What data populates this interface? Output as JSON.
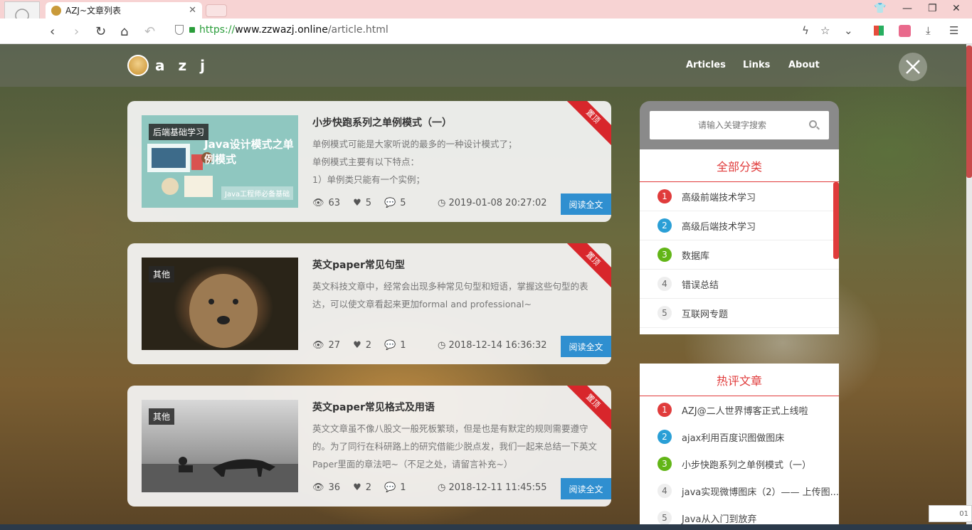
{
  "browser": {
    "tab_title": "AZJ~文章列表",
    "url_scheme": "https://",
    "url_domain": "www.zzwazj.online",
    "url_path": "/article.html"
  },
  "header": {
    "logo_text": "a z j",
    "nav": [
      "Articles",
      "Links",
      "About"
    ]
  },
  "articles": [
    {
      "thumb_tag": "后端基础学习",
      "thumb_title": "Java设计模式之单例模式",
      "thumb_sub": "Java工程师必备基础",
      "title": "小步快跑系列之单例模式（一）",
      "desc": [
        "单例模式可能是大家听说的最多的一种设计模式了；",
        "单例模式主要有以下特点：",
        "1）单例类只能有一个实例；"
      ],
      "views": "63",
      "likes": "5",
      "comments": "5",
      "date": "2019-01-08 20:27:02",
      "ribbon": "置顶",
      "read_label": "阅读全文"
    },
    {
      "thumb_tag": "其他",
      "title": "英文paper常见句型",
      "desc": [
        "英文科技文章中，经常会出现多种常见句型和短语，掌握这些句型的表达，可以使文章看起来更加formal and professional~"
      ],
      "views": "27",
      "likes": "2",
      "comments": "1",
      "date": "2018-12-14 16:36:32",
      "ribbon": "置顶",
      "read_label": "阅读全文"
    },
    {
      "thumb_tag": "其他",
      "title": "英文paper常见格式及用语",
      "desc": [
        "英文文章虽不像八股文一般死板繁琐，但是也是有默定的规则需要遵守的。为了同行在科研路上的研究借能少脱点发，我们一起来总结一下英文Paper里面的章法吧~（不足之处，请留言补充~）"
      ],
      "views": "36",
      "likes": "2",
      "comments": "1",
      "date": "2018-12-11 11:45:55",
      "ribbon": "置顶",
      "read_label": "阅读全文"
    }
  ],
  "sidebar": {
    "search_placeholder": "请输入关键字搜索",
    "categories_title": "全部分类",
    "categories": [
      {
        "num": "1",
        "label": "高级前端技术学习"
      },
      {
        "num": "2",
        "label": "高级后端技术学习"
      },
      {
        "num": "3",
        "label": "数据库"
      },
      {
        "num": "4",
        "label": "错误总结"
      },
      {
        "num": "5",
        "label": "互联网专题"
      }
    ],
    "hot_title": "热评文章",
    "hot": [
      {
        "num": "1",
        "label": "AZJ@二人世界博客正式上线啦"
      },
      {
        "num": "2",
        "label": "ajax利用百度识图做图床"
      },
      {
        "num": "3",
        "label": "小步快跑系列之单例模式（一）"
      },
      {
        "num": "4",
        "label": "java实现微博图床（2）—— 上传图..."
      },
      {
        "num": "5",
        "label": "Java从入门到放弃"
      }
    ]
  },
  "toast": {
    "text": "01"
  },
  "colors": {
    "accent_red": "#e03b3b",
    "button_blue": "#2f8fd0",
    "ribbon_red": "#d8262b"
  }
}
